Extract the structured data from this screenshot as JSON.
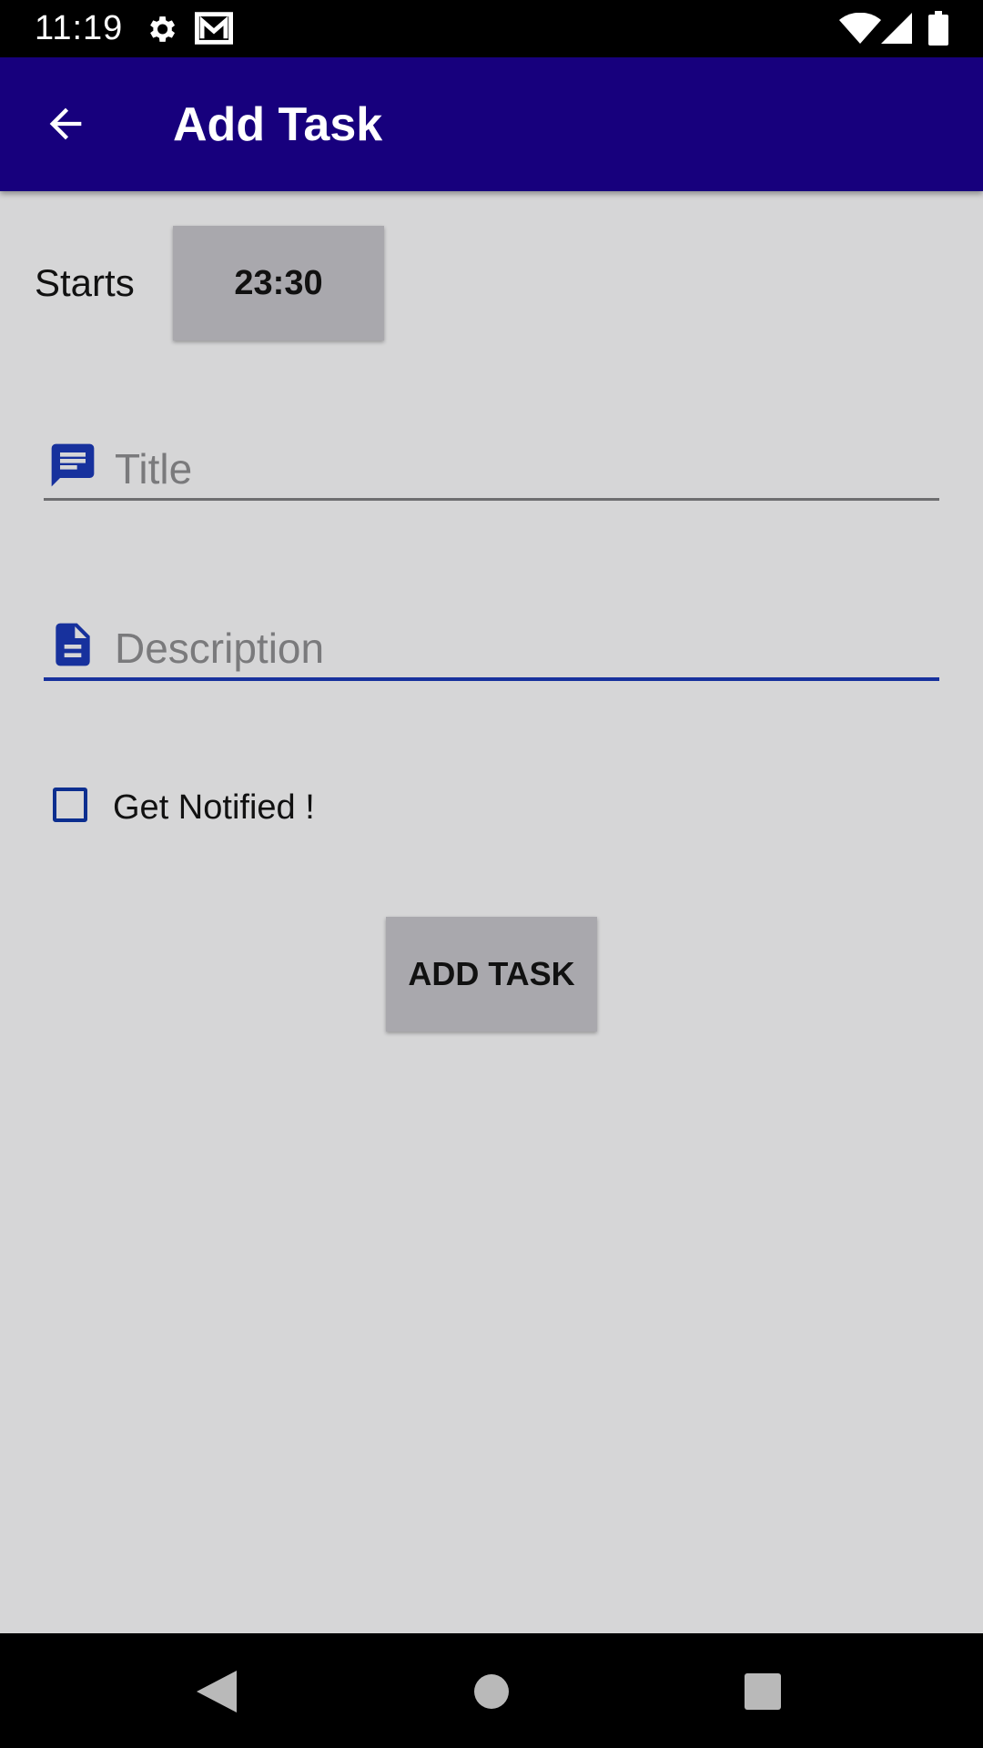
{
  "status_bar": {
    "time": "11:19",
    "icons": [
      "gear-icon",
      "mail-icon",
      "wifi-icon",
      "signal-icon",
      "battery-icon"
    ]
  },
  "app_bar": {
    "title": "Add Task",
    "back_icon": "back-arrow-icon",
    "background_color": "#17007d"
  },
  "form": {
    "starts_label": "Starts",
    "start_time": "23:30",
    "title_field": {
      "value": "",
      "placeholder": "Title",
      "icon": "chat-bubble-icon"
    },
    "description_field": {
      "value": "",
      "placeholder": "Description",
      "icon": "document-icon"
    },
    "notify_checkbox": {
      "label": "Get Notified !",
      "checked": false
    },
    "submit_label": "ADD TASK"
  },
  "nav_bar": {
    "icons": [
      "back-triangle-icon",
      "home-circle-icon",
      "recents-square-icon"
    ]
  },
  "colors": {
    "accent": "#17319d",
    "background": "#d6d6d7",
    "button": "#a9a8ad"
  }
}
